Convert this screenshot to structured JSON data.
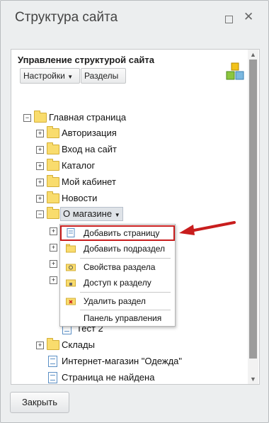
{
  "window": {
    "title": "Структура сайта"
  },
  "panel": {
    "heading": "Управление структурой сайта",
    "settings_label": "Настройки",
    "sections_label": "Разделы"
  },
  "tree": {
    "root": "Главная страница",
    "items": [
      {
        "label": "Авторизация"
      },
      {
        "label": "Вход на сайт"
      },
      {
        "label": "Каталог"
      },
      {
        "label": "Мой кабинет"
      },
      {
        "label": "Новости"
      },
      {
        "label": "О магазине"
      }
    ],
    "hidden_child": "Тест 2",
    "after": [
      {
        "label": "Склады"
      },
      {
        "label": "Интернет-магазин \"Одежда\""
      },
      {
        "label": "Страница не найдена"
      }
    ]
  },
  "context_menu": {
    "items": [
      {
        "label": "Добавить страницу"
      },
      {
        "label": "Добавить подраздел"
      },
      {
        "label": "Свойства раздела"
      },
      {
        "label": "Доступ к разделу"
      },
      {
        "label": "Удалить раздел"
      },
      {
        "label": "Панель управления"
      }
    ]
  },
  "footer": {
    "close_label": "Закрыть"
  },
  "colors": {
    "highlight": "#c81d1d",
    "folder": "#f9dc6d"
  }
}
